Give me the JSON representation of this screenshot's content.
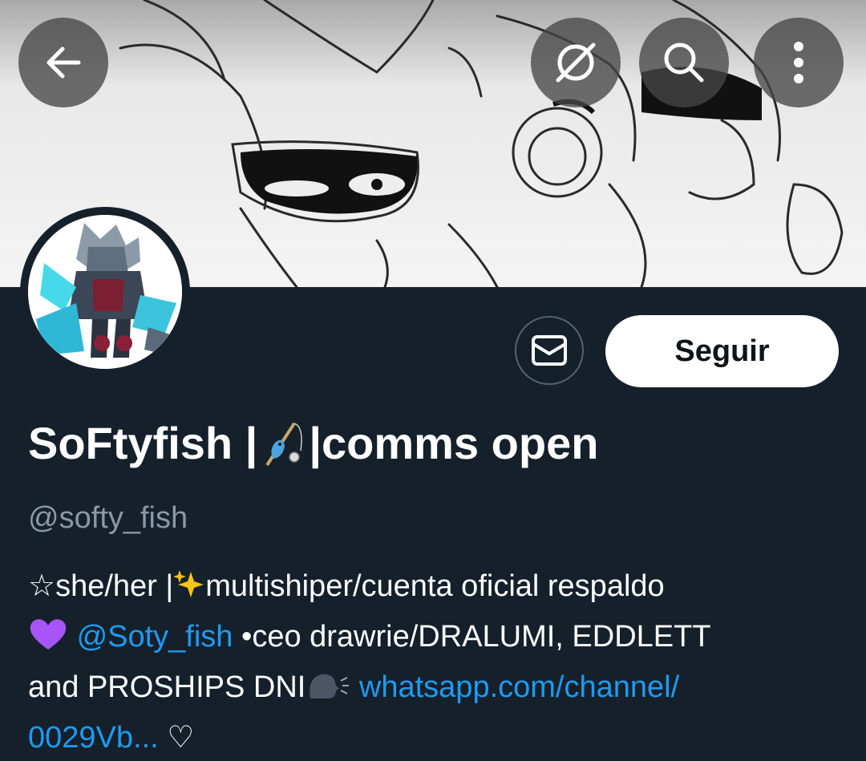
{
  "banner": {
    "description_icon": "sketch-art"
  },
  "toolbar": {
    "back_icon": "arrow-left-icon",
    "translate_icon": "translate-off-icon",
    "search_icon": "search-icon",
    "more_icon": "more-vertical-icon"
  },
  "profile": {
    "name_part1": "SoFtyfish |",
    "name_part2": "|comms open",
    "handle": "@softy_fish"
  },
  "actions": {
    "message_icon": "mail-icon",
    "follow_label": "Seguir"
  },
  "bio": {
    "line1_prefix": "☆she/her |",
    "line1_suffix": "multishiper/cuenta oficial respaldo",
    "mention": "@Soty_fish",
    "line2_rest": " •ceo drawrie/DRALUMI, EDDLETT",
    "line3_prefix": "and PROSHIPS DNI",
    "link_part1": "whatsapp.com/channel/",
    "link_part2": "0029Vb...",
    "heart": " ♡"
  },
  "colors": {
    "background": "#15202b",
    "link": "#1d9bf0",
    "secondary_text": "#8b98a5"
  }
}
